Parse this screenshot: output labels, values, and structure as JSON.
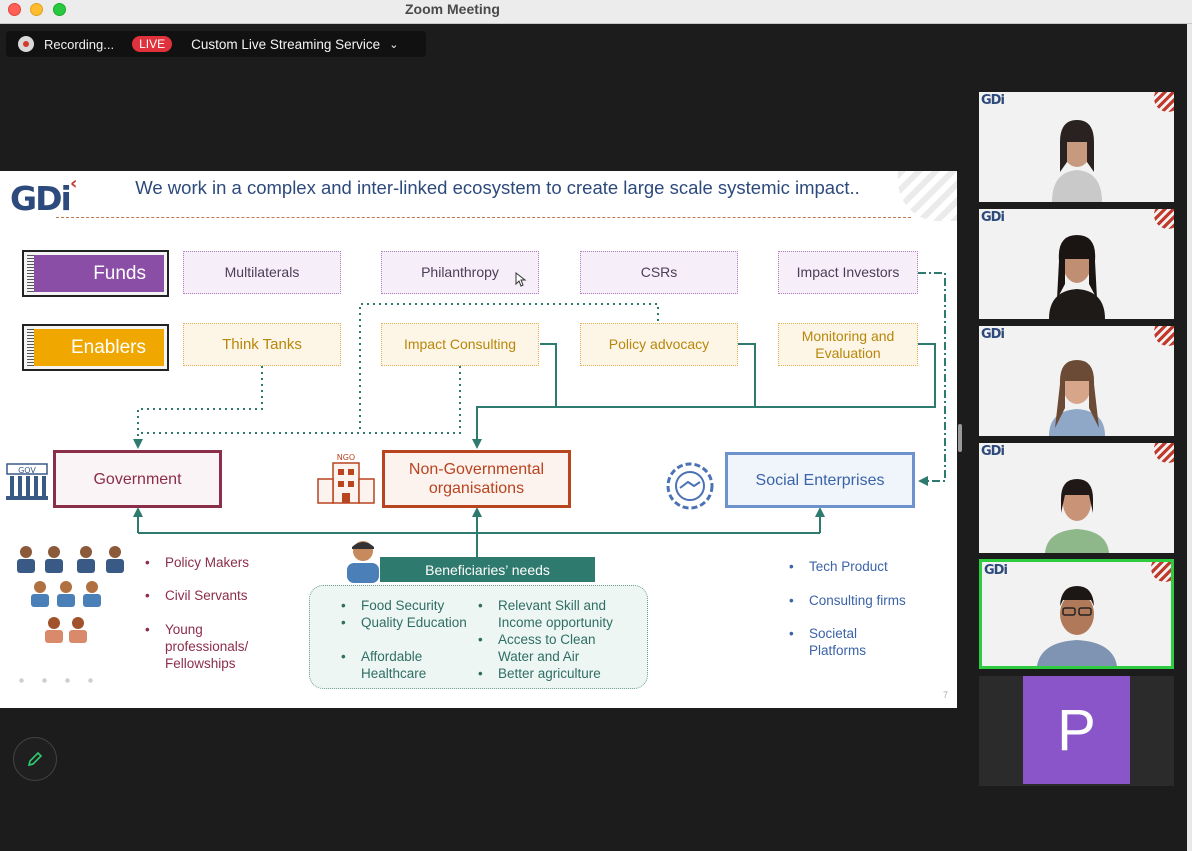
{
  "window": {
    "title": "Zoom Meeting"
  },
  "recording": {
    "status": "Recording...",
    "live_badge": "LIVE",
    "stream_service": "Custom Live Streaming Service"
  },
  "slide": {
    "logo": "GDi",
    "title": "We work in a complex and inter-linked ecosystem to create large scale systemic impact..",
    "rows": {
      "funds": {
        "label": "Funds",
        "color": "#8b4ea6",
        "items": [
          "Multilaterals",
          "Philanthropy",
          "CSRs",
          "Impact Investors"
        ]
      },
      "enablers": {
        "label": "Enablers",
        "color": "#f0a800",
        "items": [
          "Think Tanks",
          "Impact Consulting",
          "Policy advocacy",
          "Monitoring and Evaluation"
        ]
      }
    },
    "actors": {
      "government": {
        "label": "Government",
        "icon_text": "GOV",
        "bullets": [
          "Policy Makers",
          "Civil Servants",
          "Young professionals/ Fellowships"
        ]
      },
      "ngo": {
        "label": "Non-Governmental organisations",
        "icon_text": "NGO"
      },
      "social": {
        "label": "Social Enterprises",
        "bullets": [
          "Tech Product",
          "Consulting firms",
          "Societal Platforms"
        ]
      }
    },
    "beneficiaries": {
      "title": "Beneficiaries’ needs",
      "left": [
        "Food Security",
        "Quality Education",
        "Affordable Healthcare"
      ],
      "right": [
        "Relevant Skill and Income opportunity",
        "Access to Clean Water and Air",
        "Better agriculture"
      ]
    },
    "page_number": "7"
  },
  "participants": {
    "tile_logo": "GDi",
    "avatar_initial": "P"
  },
  "colors": {
    "teal": "#2f7a6e",
    "government": "#8b2e4a",
    "ngo": "#b84420",
    "social": "#4a73b5"
  }
}
